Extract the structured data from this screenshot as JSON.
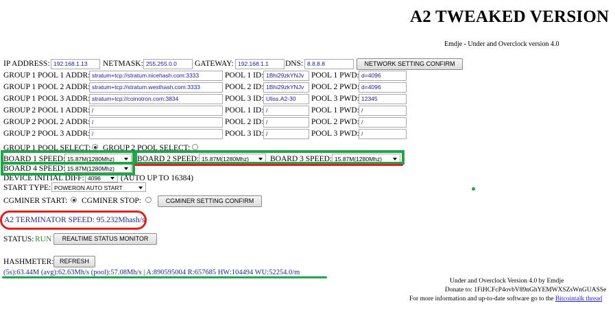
{
  "header": {
    "title": "A2 TWEAKED VERSION",
    "subtitle": "Emdje - Under and Overclock version 4.0"
  },
  "network": {
    "ip_label": "IP ADDRESS:",
    "ip_value": "192.168.1.13",
    "netmask_label": "NETMASK:",
    "netmask_value": "255.255.0.0",
    "gateway_label": "GATEWAY:",
    "gateway_value": "192.168.1.1",
    "dns_label": "DNS:",
    "dns_value": "8.8.8.8",
    "confirm_label": "NETWORK SETTING CONFIRM"
  },
  "pools": [
    {
      "addr_label": "GROUP 1 POOL 1 ADDR:",
      "addr": "stratum+tcp://stratum.nicehash.com:3333",
      "id_label": "POOL 1 ID:",
      "id": "1Bhi29zkYNJv",
      "pwd_label": "POOL 1 PWD:",
      "pwd": "d=4096"
    },
    {
      "addr_label": "GROUP 1 POOL 2 ADDR:",
      "addr": "stratum+tcp://stratum.westhash.com:3333",
      "id_label": "POOL 2 ID:",
      "id": "1Bhi29zkYNJv",
      "pwd_label": "POOL 2 PWD:",
      "pwd": "d=4096"
    },
    {
      "addr_label": "GROUP 1 POOL 3 ADDR:",
      "addr": "stratum+tcp://coinotron.com:3834",
      "id_label": "POOL 3 ID:",
      "id": "Uliss.A2-30",
      "pwd_label": "POOL 3 PWD:",
      "pwd": "12345"
    },
    {
      "addr_label": "GROUP 2 POOL 1 ADDR:",
      "addr": "/",
      "id_label": "POOL 1 ID:",
      "id": "/",
      "pwd_label": "POOL 1 PWD:",
      "pwd": "/"
    },
    {
      "addr_label": "GROUP 2 POOL 2 ADDR:",
      "addr": "/",
      "id_label": "POOL 2 ID:",
      "id": "/",
      "pwd_label": "POOL 2 PWD:",
      "pwd": "/"
    },
    {
      "addr_label": "GROUP 2 POOL 3 ADDR:",
      "addr": "/",
      "id_label": "POOL 3 ID:",
      "id": "/",
      "pwd_label": "POOL 3 PWD:",
      "pwd": "/"
    }
  ],
  "pool_select": {
    "group1_label": "GROUP 1 POOL SELECT:",
    "group2_label": "GROUP 2 POOL SELECT:"
  },
  "boards": [
    {
      "label": "BOARD 1 SPEED:",
      "value": "15.87M(1280Mhz)"
    },
    {
      "label": "BOARD 2 SPEED:",
      "value": "15.87M(1280Mhz)"
    },
    {
      "label": "BOARD 3 SPEED:",
      "value": "15.87M(1280Mhz)"
    },
    {
      "label": "BOARD 4 SPEED:",
      "value": "15.87M(1280Mhz)"
    }
  ],
  "device_diff": {
    "label": "DEVICE INITIAL DIFF:",
    "value": "4096",
    "note": "(AUTO UP TO 16384)"
  },
  "start_type": {
    "label": "START TYPE:",
    "value": "POWERON AUTO START"
  },
  "cgminer": {
    "start_label": "CGMINER START:",
    "stop_label": "CGMINER STOP:",
    "confirm_label": "CGMINER SETTING CONFIRM"
  },
  "terminator": {
    "text": "A2 TERMINATOR SPEED: 95.232Mhash/s"
  },
  "status": {
    "label": "STATUS:",
    "value": "RUN",
    "monitor_label": "REALTIME STATUS MONITOR"
  },
  "hashmeter": {
    "label": "HASHMETER:",
    "refresh_label": "REFRESH",
    "readout": "(5s):63.44M (avg):62.63Mh/s (pool):57.08Mh/s | A:890595004 R:657685 HW:104494 WU:52254.0/m"
  },
  "footer": {
    "line1": "Under and Overclock Version 4.0 by Emdje",
    "line2": "Donate to: 1FiHCFcP4ovbV89nGhYEMWXSZsWnGUASSe",
    "line3_prefix": "For more information and up-to-date software go to the",
    "link": "Bitcointalk thread"
  },
  "colors": {
    "annotation_green": "#1fa64a",
    "annotation_red": "#e0201f",
    "link": "#1a1acc"
  }
}
